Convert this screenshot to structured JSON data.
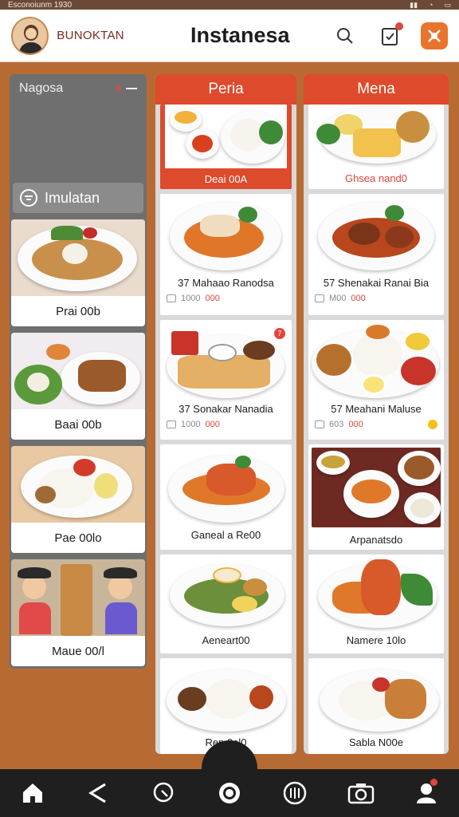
{
  "status_bar": {
    "text": "Esconoiunm 1930"
  },
  "header": {
    "brand": "BUNOKTAN",
    "title": "Instanesa"
  },
  "left_panel": {
    "title": "Nagosa",
    "filter_label": "Imulatan",
    "cards": [
      {
        "label": "Prai 00b"
      },
      {
        "label": "Baai 00b"
      },
      {
        "label": "Pae 00lo"
      },
      {
        "label": "Maue 00/l"
      }
    ]
  },
  "middle_column": {
    "title": "Peria",
    "top_banner_label": "Deai 00A",
    "items": [
      {
        "title": "37 Mahaao Ranodsa",
        "qty": "1000",
        "price": "000"
      },
      {
        "title": "37 Sonakar Nanadia",
        "qty": "1000",
        "price": "000",
        "badge": "7"
      },
      {
        "title": "Ganeal a Re00"
      },
      {
        "title": "Aeneart00"
      },
      {
        "title": "Rep 0ol0"
      }
    ]
  },
  "right_column": {
    "title": "Mena",
    "top_banner_label": "Ghsea nand0",
    "items": [
      {
        "title": "57 Shenakai Ranai Bia",
        "qty": "M00",
        "price": "000"
      },
      {
        "title": "57 Meahani Maluse",
        "qty": "603",
        "price": "000"
      },
      {
        "title": "Arpanatsdo"
      },
      {
        "title": "Namere 10lo"
      },
      {
        "title": "Sabla N00e"
      }
    ]
  },
  "bottom_nav": {
    "items": [
      "home-icon",
      "back-icon",
      "search-icon",
      "camera-shutter-icon",
      "dish-icon",
      "camera-icon",
      "profile-icon"
    ]
  },
  "colors": {
    "accent": "#de4a2c",
    "background": "#b86a33",
    "price": "#e0463a"
  }
}
